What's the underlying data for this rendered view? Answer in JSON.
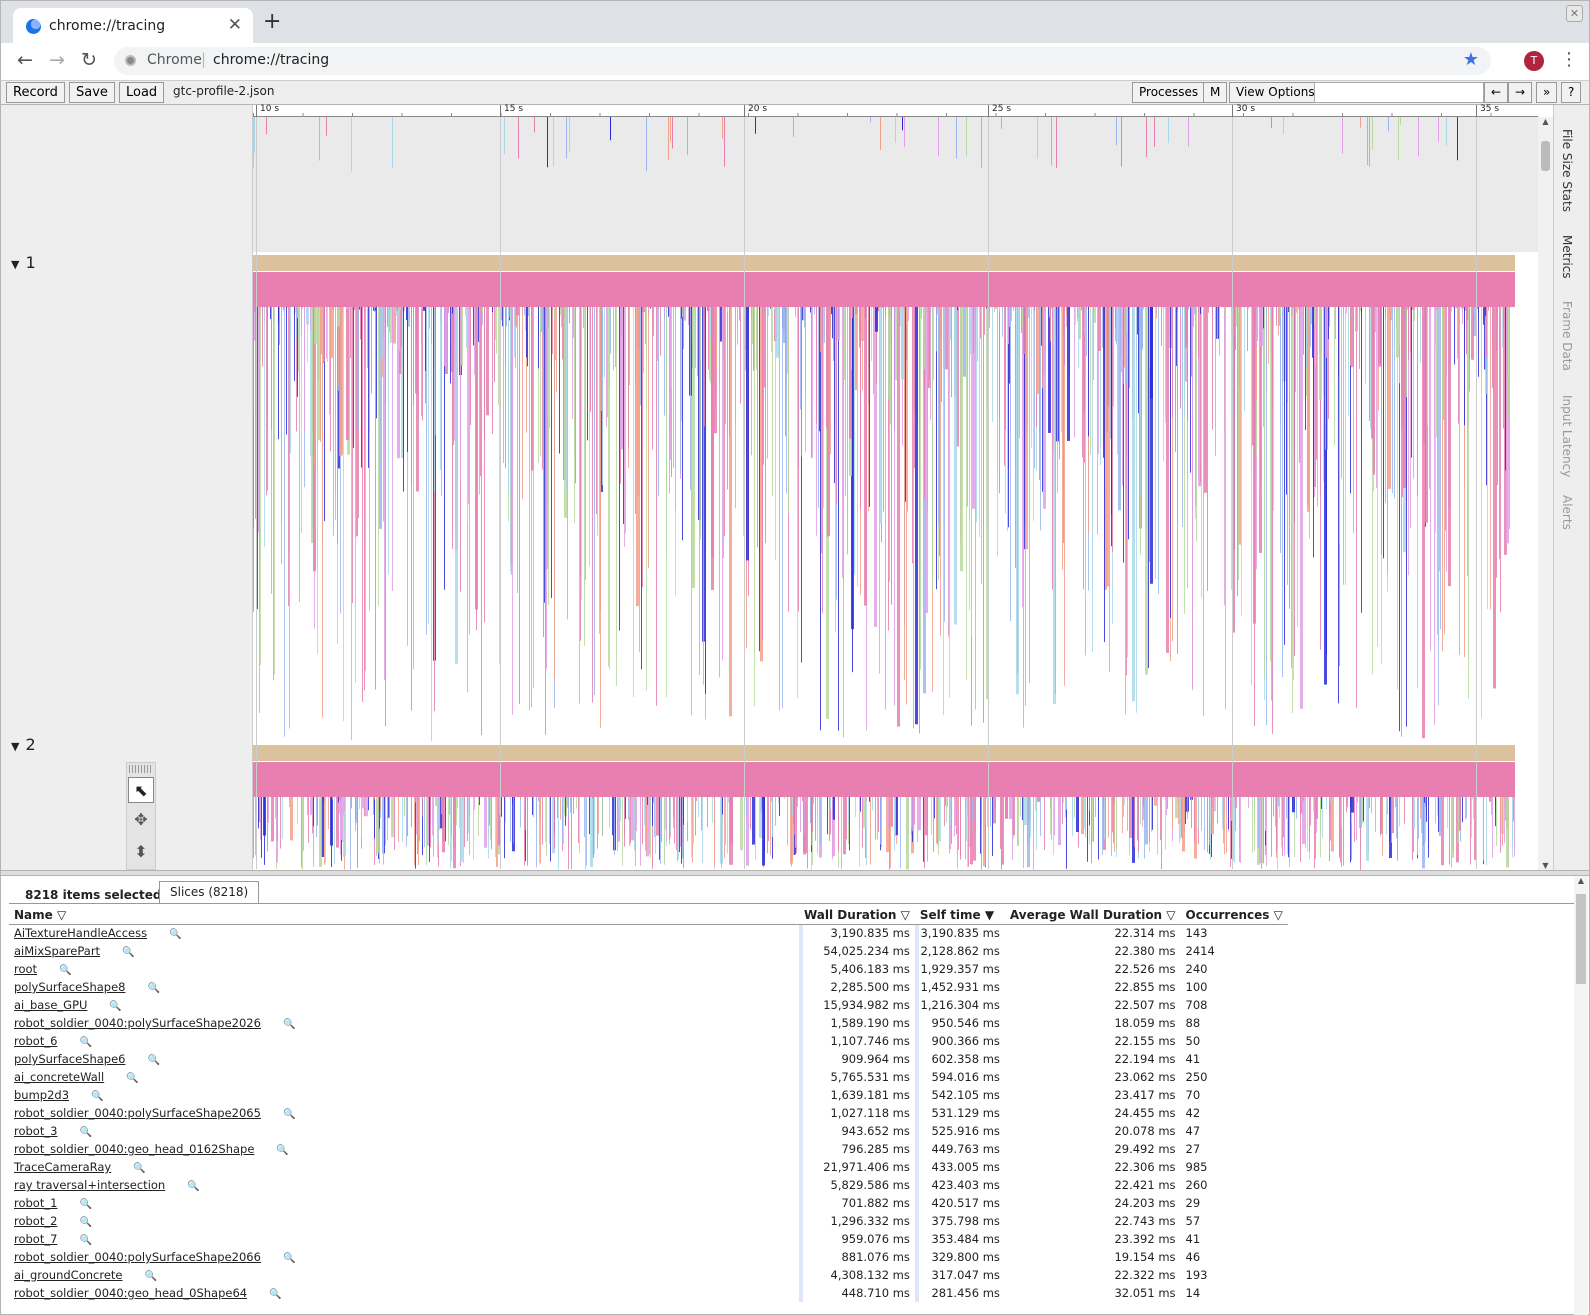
{
  "browser": {
    "tab_title": "chrome://tracing",
    "site_label": "Chrome",
    "url": "chrome://tracing",
    "avatar_initial": "T"
  },
  "tracing_toolbar": {
    "record": "Record",
    "save": "Save",
    "load": "Load",
    "filename": "gtc-profile-2.json",
    "processes": "Processes",
    "m": "M",
    "view_options": "View Options",
    "prev": "←",
    "next": "→",
    "more": "»",
    "help": "?"
  },
  "ruler_ticks": [
    "10 s",
    "15 s",
    "20 s",
    "25 s",
    "30 s",
    "35 s"
  ],
  "processes": [
    {
      "label": "1",
      "expanded": true
    },
    {
      "label": "2",
      "expanded": true
    }
  ],
  "side_tabs": [
    "File Size Stats",
    "Metrics",
    "Frame Data",
    "Input Latency",
    "Alerts"
  ],
  "analysis": {
    "selection_text": "8218 items selected.",
    "tab_label": "Slices (8218)",
    "columns": [
      "Name",
      "Wall Duration",
      "Self time",
      "Average Wall Duration",
      "Occurrences"
    ],
    "rows": [
      [
        "AiTextureHandleAccess",
        "3,190.835 ms",
        "3,190.835 ms",
        "22.314 ms",
        "143"
      ],
      [
        "aiMixSparePart",
        "54,025.234 ms",
        "2,128.862 ms",
        "22.380 ms",
        "2414"
      ],
      [
        "root",
        "5,406.183 ms",
        "1,929.357 ms",
        "22.526 ms",
        "240"
      ],
      [
        "polySurfaceShape8",
        "2,285.500 ms",
        "1,452.931 ms",
        "22.855 ms",
        "100"
      ],
      [
        "ai_base_GPU",
        "15,934.982 ms",
        "1,216.304 ms",
        "22.507 ms",
        "708"
      ],
      [
        "robot_soldier_0040:polySurfaceShape2026",
        "1,589.190 ms",
        "950.546 ms",
        "18.059 ms",
        "88"
      ],
      [
        "robot_6",
        "1,107.746 ms",
        "900.366 ms",
        "22.155 ms",
        "50"
      ],
      [
        "polySurfaceShape6",
        "909.964 ms",
        "602.358 ms",
        "22.194 ms",
        "41"
      ],
      [
        "ai_concreteWall",
        "5,765.531 ms",
        "594.016 ms",
        "23.062 ms",
        "250"
      ],
      [
        "bump2d3",
        "1,639.181 ms",
        "542.105 ms",
        "23.417 ms",
        "70"
      ],
      [
        "robot_soldier_0040:polySurfaceShape2065",
        "1,027.118 ms",
        "531.129 ms",
        "24.455 ms",
        "42"
      ],
      [
        "robot_3",
        "943.652 ms",
        "525.916 ms",
        "20.078 ms",
        "47"
      ],
      [
        "robot_soldier_0040:geo_head_0162Shape",
        "796.285 ms",
        "449.763 ms",
        "29.492 ms",
        "27"
      ],
      [
        "TraceCameraRay",
        "21,971.406 ms",
        "433.005 ms",
        "22.306 ms",
        "985"
      ],
      [
        "ray traversal+intersection",
        "5,829.586 ms",
        "423.403 ms",
        "22.421 ms",
        "260"
      ],
      [
        "robot_1",
        "701.882 ms",
        "420.517 ms",
        "24.203 ms",
        "29"
      ],
      [
        "robot_2",
        "1,296.332 ms",
        "375.798 ms",
        "22.743 ms",
        "57"
      ],
      [
        "robot_7",
        "959.076 ms",
        "353.484 ms",
        "23.392 ms",
        "41"
      ],
      [
        "robot_soldier_0040:polySurfaceShape2066",
        "881.076 ms",
        "329.800 ms",
        "19.154 ms",
        "46"
      ],
      [
        "ai_groundConcrete",
        "4,308.132 ms",
        "317.047 ms",
        "22.322 ms",
        "193"
      ],
      [
        "robot_soldier_0040:geo_head_0Shape64",
        "448.710 ms",
        "281.456 ms",
        "32.051 ms",
        "14"
      ]
    ]
  },
  "colors": {
    "slice_pink": "#e87fb0",
    "slice_tan": "#dcc29c",
    "slice_blue": "#2b2bd9",
    "slice_lightblue": "#a9d8ea",
    "slice_green": "#b8d9a0",
    "accent": "#3b73e0"
  }
}
